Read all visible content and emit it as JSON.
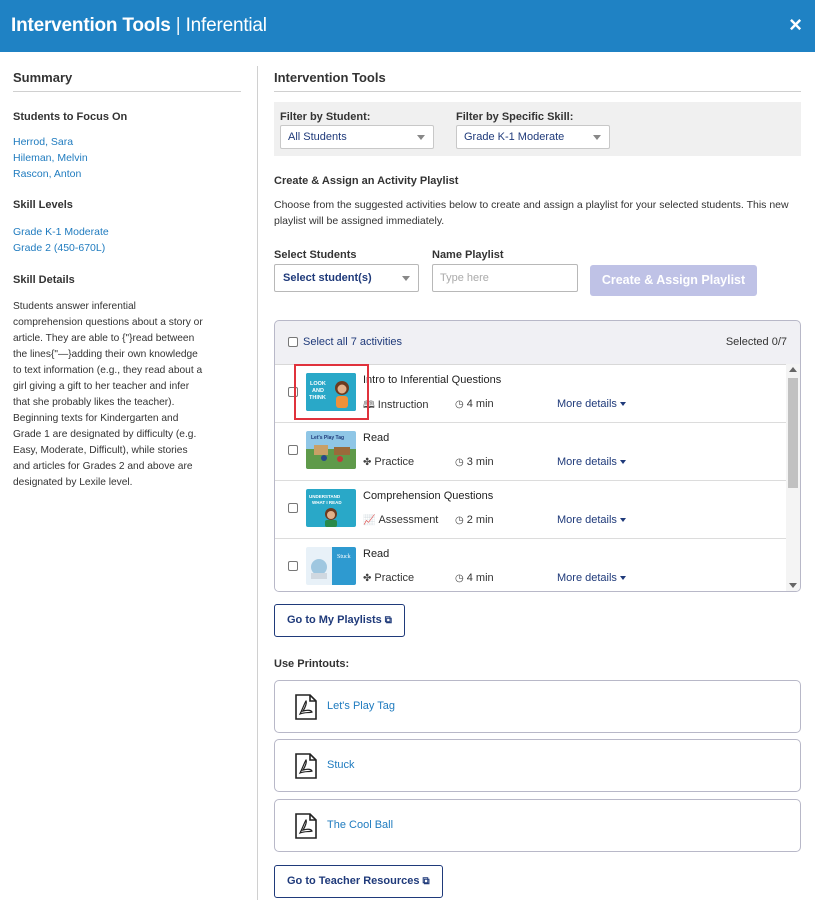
{
  "header": {
    "title_bold": "Intervention Tools",
    "separator": " | ",
    "title_rest": "Inferential",
    "close_glyph": "×"
  },
  "summary": {
    "heading": "Summary",
    "students_heading": "Students to Focus On",
    "students": [
      "Herrod, Sara",
      "Hileman, Melvin",
      "Rascon, Anton"
    ],
    "levels_heading": "Skill Levels",
    "levels": [
      "Grade K-1 Moderate",
      "Grade 2 (450-670L)"
    ],
    "details_heading": "Skill Details",
    "details_text": "Students answer inferential comprehension questions about a story or article. They are able to {\"}read between the lines{\"—}adding their own knowledge to text information (e.g., they read about a girl giving a gift to her teacher and infer that she probably likes the teacher). Beginning texts for Kindergarten and Grade 1 are designated by difficulty (e.g. Easy, Moderate, Difficult), while stories and articles for Grades 2 and above are designated by Lexile level."
  },
  "tools": {
    "heading": "Intervention Tools",
    "filter_student_label": "Filter by Student:",
    "filter_student_value": "All Students",
    "filter_skill_label": "Filter by Specific Skill:",
    "filter_skill_value": "Grade K-1 Moderate",
    "create_title": "Create & Assign an Activity Playlist",
    "create_desc": "Choose from the suggested activities below to create and assign a playlist for your selected students. This new playlist will be assigned immediately.",
    "select_students_label": "Select Students",
    "select_students_value": "Select student(s)",
    "name_playlist_label": "Name Playlist",
    "name_playlist_placeholder": "Type here",
    "create_button": "Create & Assign Playlist",
    "select_all": "Select all 7 activities",
    "selected_count": "Selected 0/7",
    "more_details": "More details",
    "activities": [
      {
        "name": "Intro to Inferential Questions",
        "type": "Instruction",
        "duration": "4 min",
        "type_icon": "instruction-icon",
        "thumb_text": "LOOK AND THINK"
      },
      {
        "name": "Read",
        "type": "Practice",
        "duration": "3 min",
        "type_icon": "puzzle-icon",
        "thumb_text": "Let's Play Tag"
      },
      {
        "name": "Comprehension Questions",
        "type": "Assessment",
        "duration": "2 min",
        "type_icon": "chart-icon",
        "thumb_text": "UNDERSTAND WHAT I READ"
      },
      {
        "name": "Read",
        "type": "Practice",
        "duration": "4 min",
        "type_icon": "puzzle-icon",
        "thumb_text": "Stuck"
      }
    ],
    "playlists_button": "Go to My Playlists",
    "printouts_title": "Use Printouts:",
    "printouts": [
      "Let's Play Tag",
      "Stuck",
      "The Cool Ball"
    ],
    "teacher_resources_button": "Go to Teacher Resources"
  },
  "colors": {
    "header_bg": "#1f82c4",
    "link": "#1f7bbf",
    "navy": "#1f3a7a",
    "disabled_button": "#bfc2e6",
    "highlight": "#e0323c"
  }
}
